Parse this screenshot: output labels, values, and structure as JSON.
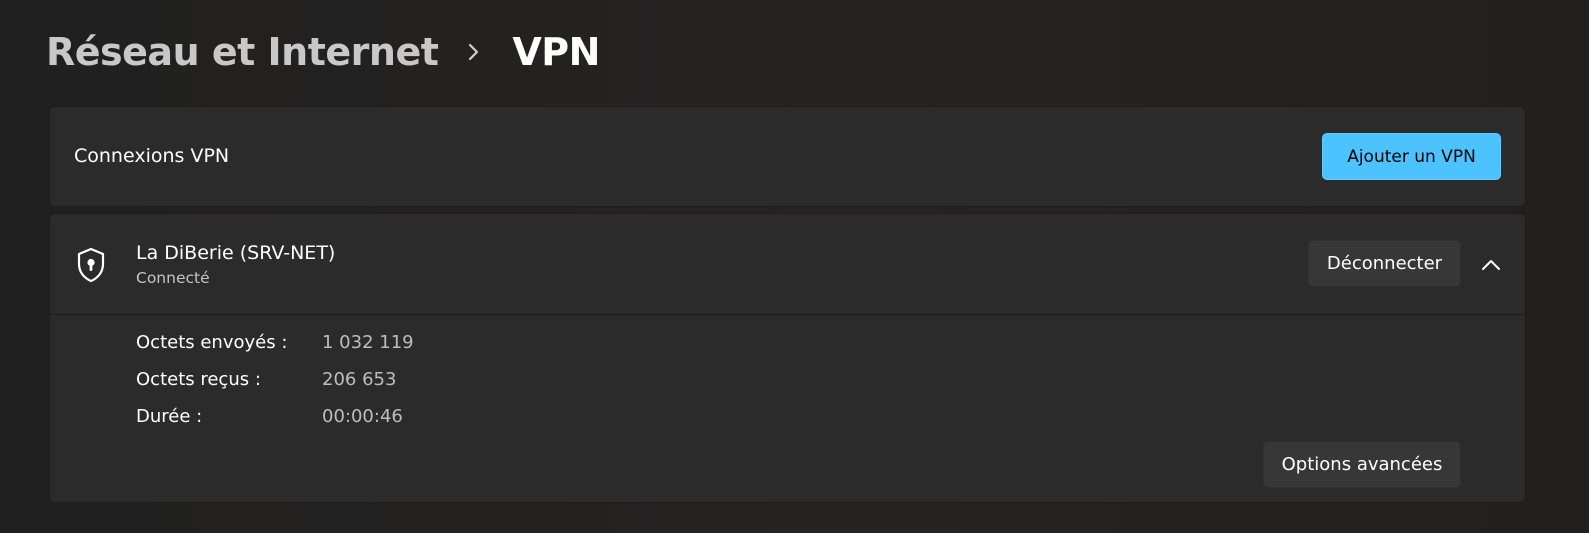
{
  "breadcrumb": {
    "parent": "Réseau et Internet",
    "current": "VPN"
  },
  "connections_card": {
    "title": "Connexions VPN",
    "add_button": "Ajouter un VPN"
  },
  "vpn": {
    "name": "La DiBerie (SRV-NET)",
    "status": "Connecté",
    "disconnect_button": "Déconnecter",
    "stats": [
      {
        "label": "Octets envoyés :",
        "value": "1 032 119"
      },
      {
        "label": "Octets reçus :",
        "value": "206 653"
      },
      {
        "label": "Durée :",
        "value": "00:00:46"
      }
    ],
    "advanced_button": "Options avancées"
  },
  "icons": {
    "breadcrumb_separator": "chevron-right-icon",
    "vpn_icon": "shield-lock-icon",
    "collapse": "chevron-up-icon"
  },
  "colors": {
    "accent": "#4cc2ff",
    "background": "#202020",
    "card": "#2b2b2b"
  }
}
